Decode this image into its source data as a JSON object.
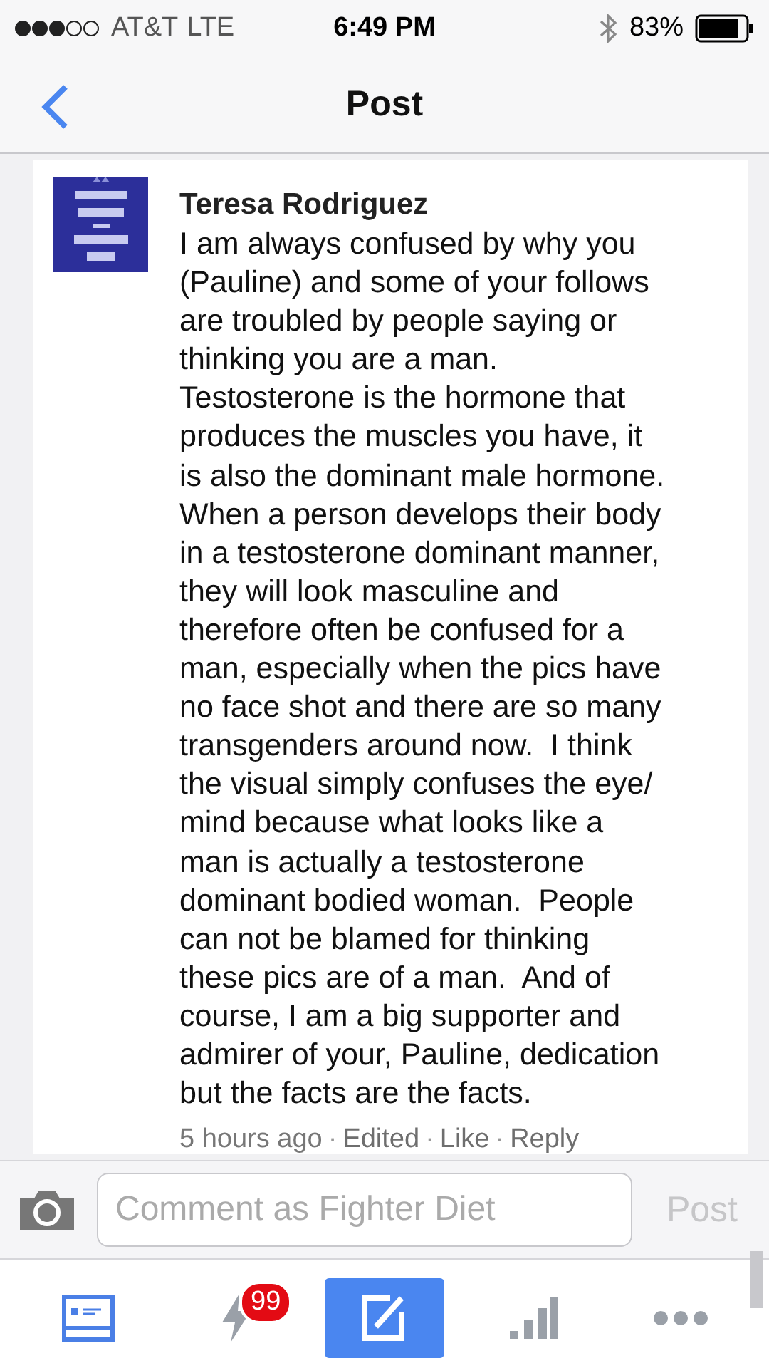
{
  "status_bar": {
    "carrier": "AT&T",
    "network": "LTE",
    "time": "6:49 PM",
    "battery": "83%"
  },
  "nav": {
    "title": "Post"
  },
  "comment": {
    "author": "Teresa Rodriguez",
    "text": "I am always confused by why you\n(Pauline) and some of your follows\nare troubled by people saying or\nthinking you are a man.\nTestosterone is the hormone that\nproduces the muscles you have, it\nis also the dominant male hormone.\nWhen a person develops their body\nin a testosterone dominant manner,\nthey will look masculine and\ntherefore often be confused for a\nman, especially when the pics have\nno face shot and there are so many\ntransgenders around now.  I think\nthe visual simply confuses the eye/\nmind because what looks like a\nman is actually a testosterone\ndominant bodied woman.  People\ncan not be blamed for thinking\nthese pics are of a man.  And of\ncourse, I am a big supporter and\nadmirer of your, Pauline, dedication\nbut the facts are the facts.",
    "separator": "·",
    "meta": [
      {
        "label": "5 hours ago",
        "kind": "time"
      },
      {
        "label": "Edited",
        "kind": "link"
      },
      {
        "label": "Like",
        "kind": "link"
      },
      {
        "label": "Reply",
        "kind": "link"
      }
    ]
  },
  "composer": {
    "placeholder": "Comment as Fighter Diet",
    "post_button": "Post",
    "disabled": true
  },
  "tab_bar": [
    {
      "kind": "news",
      "selected": false
    },
    {
      "kind": "notifications",
      "selected": false,
      "badge": "99"
    },
    {
      "kind": "compose",
      "selected": true
    },
    {
      "kind": "activity",
      "selected": false
    },
    {
      "kind": "more",
      "selected": false
    }
  ]
}
